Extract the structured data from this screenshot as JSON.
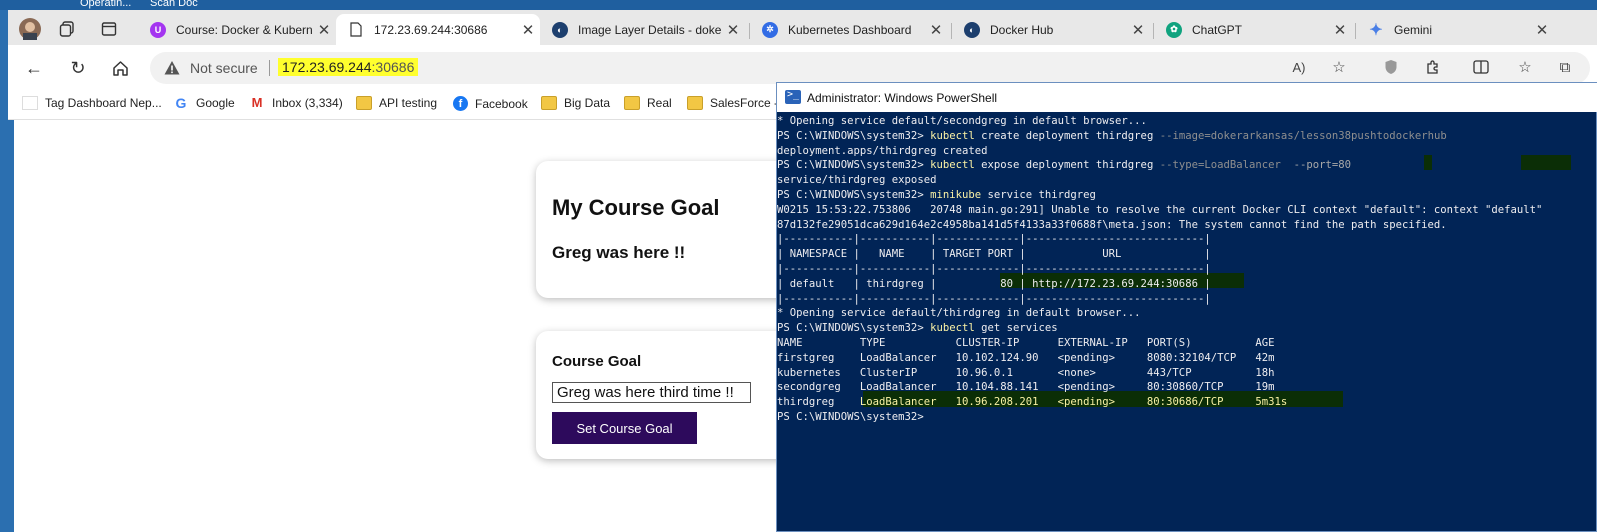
{
  "desktop": {
    "icon1_label": "Operatin...",
    "icon2_label": "Scan Doc"
  },
  "tabs": [
    {
      "title": "Course: Docker & Kubernet",
      "icon": "udemy-icon",
      "color": "#a435f0"
    },
    {
      "title": "172.23.69.244:30686",
      "icon": "page-icon",
      "color": "#ffffff"
    },
    {
      "title": "Image Layer Details - doke",
      "icon": "docker-icon",
      "color": "#1d3f6e"
    },
    {
      "title": "Kubernetes Dashboard",
      "icon": "kubernetes-icon",
      "color": "#326ce5"
    },
    {
      "title": "Docker Hub",
      "icon": "docker-icon",
      "color": "#1d3f6e"
    },
    {
      "title": "ChatGPT",
      "icon": "chatgpt-icon",
      "color": "#10a37f"
    },
    {
      "title": "Gemini",
      "icon": "gemini-icon",
      "color": "#4a7fe6"
    }
  ],
  "address": {
    "security": "Not secure",
    "host": "172.23.69.244",
    "port": ":30686",
    "highlight": "#ffff2e"
  },
  "bookmarks": [
    {
      "label": "Tag Dashboard Nep...",
      "icon": "page-icon"
    },
    {
      "label": "Google",
      "icon": "google-icon"
    },
    {
      "label": "Inbox (3,334)",
      "icon": "gmail-icon"
    },
    {
      "label": "API testing",
      "icon": "folder-icon"
    },
    {
      "label": "Facebook",
      "icon": "facebook-icon"
    },
    {
      "label": "Big Data",
      "icon": "folder-icon"
    },
    {
      "label": "Real",
      "icon": "folder-icon"
    },
    {
      "label": "SalesForce -",
      "icon": "folder-icon"
    }
  ],
  "page": {
    "goal_heading": "My Course Goal",
    "goal_text": "Greg was here !!",
    "form_label": "Course Goal",
    "form_value": "Greg was here third time !!",
    "button_label": "Set Course Goal",
    "button_color": "#2d0a5c"
  },
  "powershell": {
    "title": "Administrator: Windows PowerShell",
    "bg_color": "#012456",
    "lines": [
      [
        [
          "t",
          "* Opening service default/secondgreg in default browser..."
        ]
      ],
      [
        [
          "t",
          "PS C:\\WINDOWS\\system32> "
        ],
        [
          "y",
          "kubectl"
        ],
        [
          "t",
          " create deployment thirdgreg "
        ],
        [
          "g",
          "--image=dokerarkansas/lesson38pushtodockerhub"
        ]
      ],
      [
        [
          "t",
          "deployment.apps/thirdgreg created"
        ]
      ],
      [
        [
          "t",
          "PS C:\\WINDOWS\\system32> "
        ],
        [
          "y",
          "kubectl"
        ],
        [
          "t",
          " expose deployment thirdgreg "
        ],
        [
          "g",
          "--type=LoadBalancer  "
        ],
        [
          "gh",
          "--port=80"
        ]
      ],
      [
        [
          "t",
          "service/thirdgreg exposed"
        ]
      ],
      [
        [
          "t",
          "PS C:\\WINDOWS\\system32> "
        ],
        [
          "y",
          "minikube"
        ],
        [
          "t",
          " service thirdgreg"
        ]
      ],
      [
        [
          "t",
          "W0215 15:53:22.753806   20748 main.go:291] Unable to resolve the current Docker CLI context \"default\": context \"default\""
        ]
      ],
      [
        [
          "t",
          "87d132fe29051dca629d164e2c4958ba141d5f4133a33f0688f\\meta.json: The system cannot find the path specified."
        ]
      ],
      [
        [
          "t",
          "|-----------|-----------|-------------|----------------------------|"
        ]
      ],
      [
        [
          "t",
          "| NAMESPACE |   NAME    | TARGET PORT |            URL             |"
        ]
      ],
      [
        [
          "t",
          "|-----------|-----------|-------------|----------------------------|"
        ]
      ],
      [
        [
          "t",
          "| default   | thirdgreg |          80 | http://172.23.69.244:30686 |"
        ]
      ],
      [
        [
          "t",
          "|-----------|-----------|-------------|----------------------------|"
        ]
      ],
      [
        [
          "t",
          "* Opening service default/thirdgreg in default browser..."
        ]
      ],
      [
        [
          "t",
          "PS C:\\WINDOWS\\system32> "
        ],
        [
          "y",
          "kubectl"
        ],
        [
          "t",
          " get services"
        ]
      ],
      [
        [
          "t",
          "NAME         TYPE           CLUSTER-IP      EXTERNAL-IP   PORT(S)          AGE"
        ]
      ],
      [
        [
          "t",
          "firstgreg    LoadBalancer   10.102.124.90   <pending>     8080:32104/TCP   42m"
        ]
      ],
      [
        [
          "t",
          "kubernetes   ClusterIP      10.96.0.1       <none>        443/TCP          18h"
        ]
      ],
      [
        [
          "t",
          "secondgreg   LoadBalancer   10.104.88.141   <pending>     80:30860/TCP     19m"
        ]
      ],
      [
        [
          "t",
          "thirdgreg    "
        ],
        [
          "y",
          "LoadBalancer   10.96.208.201   <pending>     80:30686/TCP     5m31s"
        ]
      ],
      [
        [
          "t",
          "PS C:\\WINDOWS\\system32>"
        ]
      ]
    ]
  }
}
